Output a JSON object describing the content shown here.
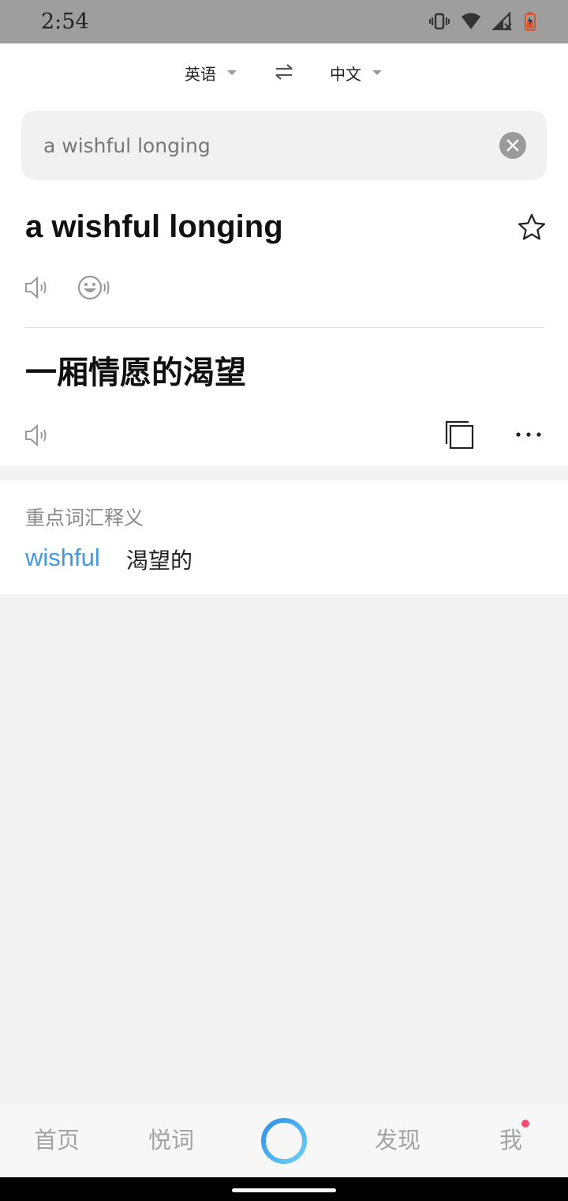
{
  "status_bar": {
    "time": "2:54",
    "icons": [
      "vibrate-icon",
      "wifi-icon",
      "signal-off-icon",
      "battery-icon"
    ]
  },
  "language_bar": {
    "source_language": "英语",
    "target_language": "中文"
  },
  "search": {
    "value": "a wishful longing",
    "placeholder": ""
  },
  "result": {
    "source_text": "a wishful longing",
    "translation": "一厢情愿的渴望"
  },
  "vocabulary": {
    "heading": "重点词汇释义",
    "items": [
      {
        "word": "wishful",
        "definition": "渴望的"
      }
    ]
  },
  "bottom_nav": {
    "items": [
      {
        "label": "首页"
      },
      {
        "label": "悦词"
      },
      {
        "label": "发现"
      },
      {
        "label": "我"
      }
    ]
  },
  "colors": {
    "status_bar": "#9e9e9e",
    "accent_blue": "#3e98e6",
    "badge_red": "#f0506e"
  }
}
